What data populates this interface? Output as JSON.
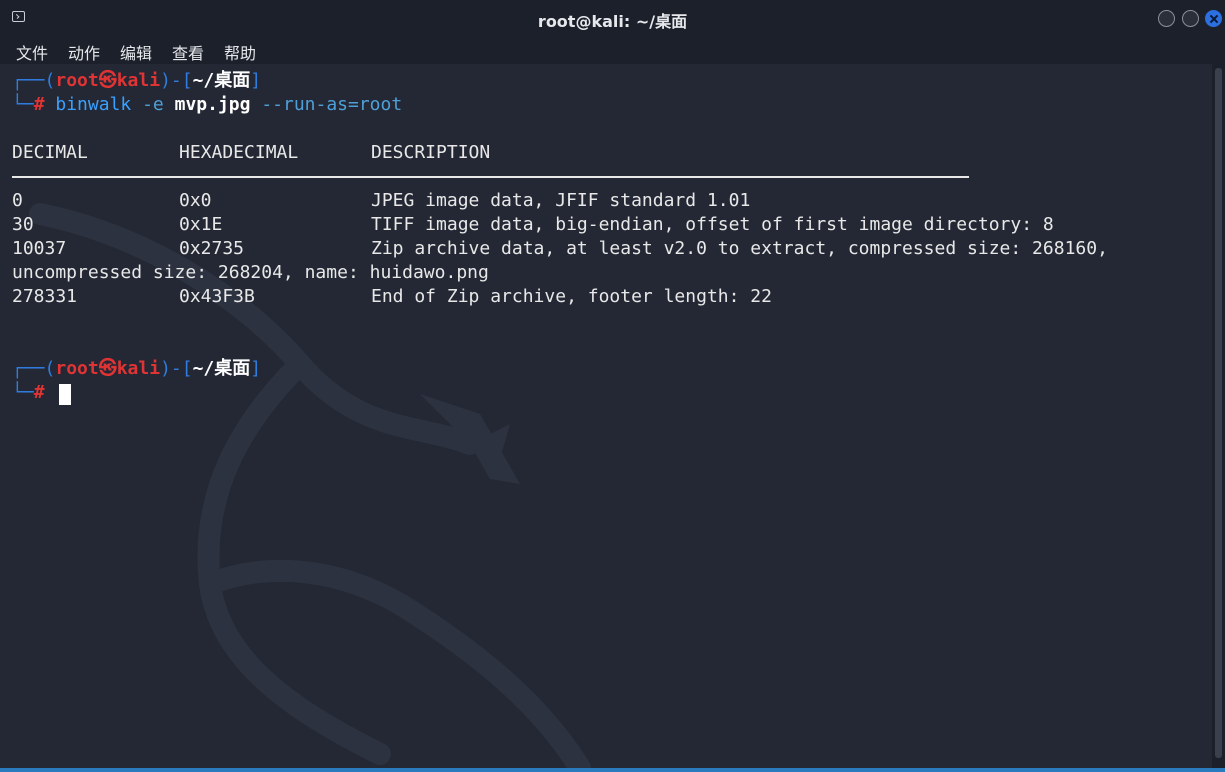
{
  "window": {
    "title": "root@kali: ~/桌面"
  },
  "menu": {
    "items": [
      "文件",
      "动作",
      "编辑",
      "查看",
      "帮助"
    ]
  },
  "prompt1": {
    "corner_top": "┌──(",
    "user": "root",
    "at": "㉿",
    "host": "kali",
    "mid": ")-[",
    "path": "~/桌面",
    "close": "]",
    "corner_bottom": "└─",
    "hash": "#",
    "command": "binwalk",
    "flag": "-e",
    "argument": "mvp.jpg",
    "option": "--run-as=root"
  },
  "table": {
    "headers": [
      "DECIMAL",
      "HEXADECIMAL",
      "DESCRIPTION"
    ],
    "rows": [
      {
        "decimal": "0",
        "hex": "0x0",
        "description": "JPEG image data, JFIF standard 1.01"
      },
      {
        "decimal": "30",
        "hex": "0x1E",
        "description": "TIFF image data, big-endian, offset of first image directory: 8"
      },
      {
        "decimal": "10037",
        "hex": "0x2735",
        "description": "Zip archive data, at least v2.0 to extract, compressed size: 268160,"
      },
      {
        "decimal": "",
        "hex": "",
        "description": "uncompressed size: 268204, name: huidawo.png"
      },
      {
        "decimal": "278331",
        "hex": "0x43F3B",
        "description": "End of Zip archive, footer length: 22"
      }
    ]
  },
  "prompt2": {
    "corner_top": "┌──(",
    "user": "root",
    "at": "㉿",
    "host": "kali",
    "mid": ")-[",
    "path": "~/桌面",
    "close": "]",
    "corner_bottom": "└─",
    "hash": "#"
  },
  "colors": {
    "background": "#232834",
    "prompt_frame": "#2f7de1",
    "prompt_user": "#e03434",
    "command": "#3aa0ff",
    "text": "#e8e8e8"
  }
}
